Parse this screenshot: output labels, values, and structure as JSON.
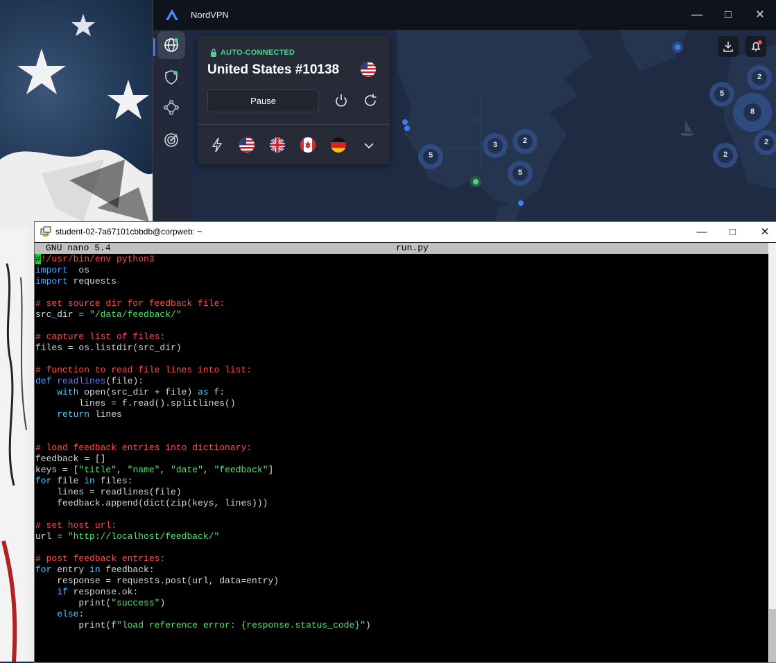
{
  "nordvpn": {
    "title": "NordVPN",
    "status": "AUTO-CONNECTED",
    "server": "United States #10138",
    "pause_label": "Pause",
    "quick_connect_flags": [
      "united-states-flag",
      "united-kingdom-flag",
      "canada-flag",
      "germany-flag"
    ],
    "map_clusters": [
      "5",
      "3",
      "2",
      "5",
      "2",
      "5",
      "8",
      "2",
      "2"
    ],
    "accent_color": "#3e7bfa",
    "connected_color": "#4ed28a"
  },
  "terminal": {
    "title": "student-02-7a67101cbbdb@corpweb: ~",
    "nano_version": "GNU nano 5.4",
    "filename": "run.py"
  },
  "code_lines": [
    [
      [
        "cm",
        "!/usr/bin/env python3"
      ]
    ],
    [
      [
        "kw",
        "import"
      ],
      [
        "",
        "  os"
      ]
    ],
    [
      [
        "kw",
        "import"
      ],
      [
        "",
        " requests"
      ]
    ],
    [],
    [
      [
        "cm",
        "# set source dir for feedback file:"
      ]
    ],
    [
      [
        "",
        "src_dir = "
      ],
      [
        "st",
        "\"/data/feedback/\""
      ]
    ],
    [],
    [
      [
        "cm",
        "# capture list of files:"
      ]
    ],
    [
      [
        "",
        "files = os.listdir(src_dir)"
      ]
    ],
    [],
    [
      [
        "cm",
        "# function to read file lines into list:"
      ]
    ],
    [
      [
        "kw",
        "def"
      ],
      [
        "",
        " "
      ],
      [
        "fn",
        "readlines"
      ],
      [
        "",
        "(file):"
      ]
    ],
    [
      [
        "",
        "    "
      ],
      [
        "kw2",
        "with"
      ],
      [
        "",
        " open(src_dir + file) "
      ],
      [
        "kw2",
        "as"
      ],
      [
        "",
        " f:"
      ]
    ],
    [
      [
        "",
        "        lines = f.read().splitlines()"
      ]
    ],
    [
      [
        "",
        "    "
      ],
      [
        "kw2",
        "return"
      ],
      [
        "",
        " lines"
      ]
    ],
    [],
    [],
    [
      [
        "cm",
        "# load feedback entries into dictionary:"
      ]
    ],
    [
      [
        "",
        "feedback = []"
      ]
    ],
    [
      [
        "",
        "keys = ["
      ],
      [
        "st",
        "\"title\""
      ],
      [
        "",
        ", "
      ],
      [
        "st",
        "\"name\""
      ],
      [
        "",
        ", "
      ],
      [
        "st",
        "\"date\""
      ],
      [
        "",
        ", "
      ],
      [
        "st",
        "\"feedback\""
      ],
      [
        "",
        "]"
      ]
    ],
    [
      [
        "kw2",
        "for"
      ],
      [
        "",
        " file "
      ],
      [
        "kw2",
        "in"
      ],
      [
        "",
        " files:"
      ]
    ],
    [
      [
        "",
        "    lines = readlines(file)"
      ]
    ],
    [
      [
        "",
        "    feedback.append(dict(zip(keys, lines)))"
      ]
    ],
    [],
    [
      [
        "cm",
        "# set host url:"
      ]
    ],
    [
      [
        "",
        "url = "
      ],
      [
        "st",
        "\"http://localhost/feedback/\""
      ]
    ],
    [],
    [
      [
        "cm",
        "# post feedback entries:"
      ]
    ],
    [
      [
        "kw2",
        "for"
      ],
      [
        "",
        " entry "
      ],
      [
        "kw2",
        "in"
      ],
      [
        "",
        " feedback:"
      ]
    ],
    [
      [
        "",
        "    response = requests.post(url, data=entry)"
      ]
    ],
    [
      [
        "",
        "    "
      ],
      [
        "kw2",
        "if"
      ],
      [
        "",
        " response.ok:"
      ]
    ],
    [
      [
        "",
        "        print("
      ],
      [
        "st",
        "\"success\""
      ],
      [
        "",
        ")"
      ]
    ],
    [
      [
        "",
        "    "
      ],
      [
        "kw2",
        "else"
      ],
      [
        "",
        ":"
      ]
    ],
    [
      [
        "",
        "        print(f"
      ],
      [
        "st",
        "\"load reference error: {response.status_code}\""
      ],
      [
        "",
        ")"
      ]
    ]
  ]
}
